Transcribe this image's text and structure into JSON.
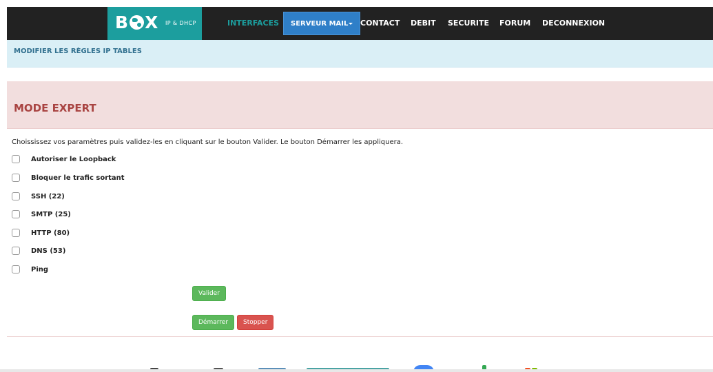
{
  "header": {
    "logo_text_left": "B",
    "logo_text_right": "X",
    "logo_subtitle": "IP & DHCP",
    "nav": [
      {
        "label": "INTERFACES",
        "active": true
      },
      {
        "label": "SERVEUR MAIL",
        "dropdown": true
      },
      {
        "label": "CONTACT"
      },
      {
        "label": "DEBIT"
      },
      {
        "label": "SECURITE"
      },
      {
        "label": "FORUM"
      },
      {
        "label": "DECONNEXION"
      }
    ]
  },
  "breadcrumb": {
    "text": "MODIFIER LES RÈGLES IP TABLES"
  },
  "panel": {
    "title": "MODE EXPERT"
  },
  "instructions": "Choississez vos paramètres puis validez-les en cliquant sur le bouton Valider. Le bouton Démarrer les appliquera.",
  "options": [
    {
      "label": "Autoriser le Loopback",
      "checked": false
    },
    {
      "label": "Bloquer le trafic sortant",
      "checked": false
    },
    {
      "label": "SSH (22)",
      "checked": false
    },
    {
      "label": "SMTP (25)",
      "checked": false
    },
    {
      "label": "HTTP (80)",
      "checked": false
    },
    {
      "label": "DNS (53)",
      "checked": false
    },
    {
      "label": "Ping",
      "checked": false
    }
  ],
  "buttons": {
    "validate": "Valider",
    "start": "Démarrer",
    "stop": "Stopper"
  },
  "colors": {
    "nav_bg": "#222222",
    "brand_teal": "#1c9e9e",
    "dropdown_blue": "#2f7fc8",
    "success_green": "#5cb85c",
    "danger_red": "#d9534f",
    "info_bg": "#daeff6",
    "danger_bg": "#f2dede"
  }
}
